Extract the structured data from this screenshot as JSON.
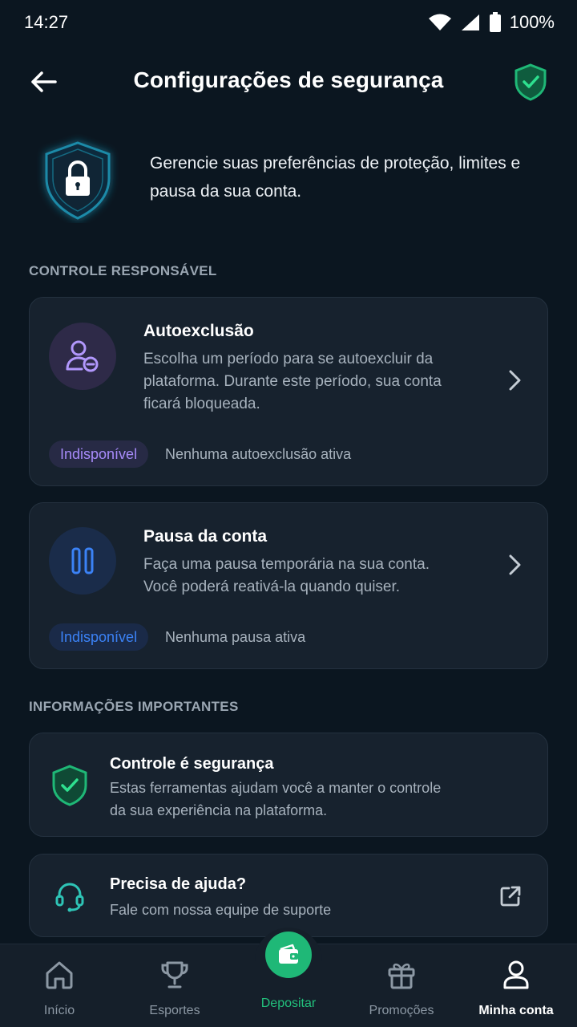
{
  "status_bar": {
    "time": "14:27",
    "battery": "100%"
  },
  "header": {
    "title": "Configurações de segurança"
  },
  "intro": {
    "text": "Gerencie suas preferências de proteção, limites e pausa da sua conta."
  },
  "sections": {
    "responsible": "CONTROLE RESPONSÁVEL",
    "important": "INFORMAÇÕES IMPORTANTES"
  },
  "cards": {
    "self_exclusion": {
      "title": "Autoexclusão",
      "desc_lines": [
        "Escolha um período para se autoexcluir da",
        "plataforma. Durante este período, sua conta",
        "ficará bloqueada."
      ],
      "badge": "Indisponível",
      "note": "Nenhuma autoexclusão ativa",
      "accent": "#a78bfa"
    },
    "pause": {
      "title": "Pausa da conta",
      "desc_lines": [
        "Faça uma pausa temporária na sua conta.",
        "Você poderá reativá-la quando quiser."
      ],
      "badge": "Indisponível",
      "note": "Nenhuma pausa ativa",
      "accent": "#3b82f6"
    },
    "control": {
      "title": "Controle é segurança",
      "desc_lines": [
        "Estas ferramentas ajudam você a manter o controle",
        "da sua experiência na plataforma."
      ]
    },
    "help": {
      "title": "Precisa de ajuda?",
      "desc": "Fale com nossa equipe de suporte"
    }
  },
  "bottom_nav": {
    "home": "Início",
    "sports": "Esportes",
    "deposit": "Depositar",
    "promotions": "Promoções",
    "account": "Minha conta"
  },
  "colors": {
    "brand_green": "#1fb877",
    "background": "#0b1620",
    "card": "#17222e"
  },
  "icons": [
    "wifi-icon",
    "signal-icon",
    "battery-icon",
    "back-arrow-icon",
    "shield-check-icon",
    "shield-lock-icon",
    "user-minus-icon",
    "pause-icon",
    "chevron-right-icon",
    "headset-icon",
    "external-link-icon",
    "home-icon",
    "trophy-icon",
    "wallet-icon",
    "gift-icon",
    "user-icon"
  ]
}
